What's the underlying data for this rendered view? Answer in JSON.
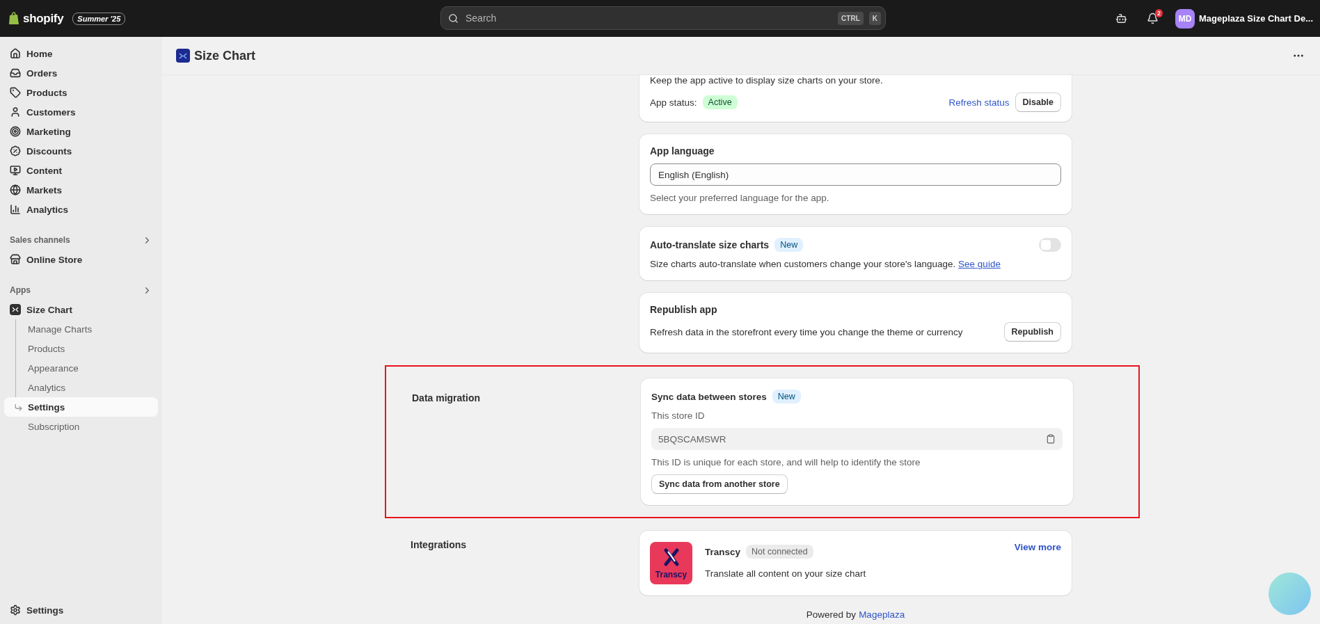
{
  "top_bar": {
    "logo_text": "shopify",
    "edition_badge": "Summer '25",
    "search": {
      "placeholder": "Search"
    },
    "shortcut_keys": [
      "CTRL",
      "K"
    ],
    "notification_count": "2",
    "account": {
      "initials": "MD",
      "name": "Mageplaza Size Chart De..."
    }
  },
  "sidebar": {
    "items": [
      {
        "label": "Home"
      },
      {
        "label": "Orders"
      },
      {
        "label": "Products"
      },
      {
        "label": "Customers"
      },
      {
        "label": "Marketing"
      },
      {
        "label": "Discounts"
      },
      {
        "label": "Content"
      },
      {
        "label": "Markets"
      },
      {
        "label": "Analytics"
      }
    ],
    "sales_channels": {
      "label": "Sales channels",
      "items": [
        {
          "label": "Online Store"
        }
      ]
    },
    "apps": {
      "label": "Apps",
      "app": {
        "label": "Size Chart",
        "children": [
          {
            "label": "Manage Charts",
            "selected": false
          },
          {
            "label": "Products",
            "selected": false
          },
          {
            "label": "Appearance",
            "selected": false
          },
          {
            "label": "Analytics",
            "selected": false
          },
          {
            "label": "Settings",
            "selected": true
          },
          {
            "label": "Subscription",
            "selected": false
          }
        ]
      }
    },
    "footer_item": {
      "label": "Settings"
    }
  },
  "page": {
    "title": "Size Chart"
  },
  "app_status_card": {
    "description": "Keep the app active to display size charts on your store.",
    "status_label": "App status:",
    "status_badge": "Active",
    "refresh_link": "Refresh status",
    "disable_button": "Disable"
  },
  "language_card": {
    "title": "App language",
    "value": "English (English)",
    "help": "Select your preferred language for the app."
  },
  "auto_translate_card": {
    "title": "Auto-translate size charts",
    "badge": "New",
    "on": false,
    "description": "Size charts auto-translate when customers change your store's language.",
    "link": "See guide"
  },
  "republish_card": {
    "title": "Republish app",
    "description": "Refresh data in the storefront every time you change the theme or currency",
    "button": "Republish"
  },
  "data_migration": {
    "label": "Data migration",
    "highlighted": true,
    "title": "Sync data between stores",
    "badge": "New",
    "field_label": "This store ID",
    "store_id": "5BQSCAMSWR",
    "help": "This ID is unique for each store, and will help to identify the store",
    "button": "Sync data from another store"
  },
  "integrations": {
    "label": "Integrations",
    "items": [
      {
        "name": "Transcy",
        "logo_text": "Transcy",
        "status": "Not connected",
        "description": "Translate all content on your size chart"
      }
    ],
    "link": "View more"
  },
  "footer": {
    "text": "Powered by",
    "link": "Mageplaza"
  }
}
